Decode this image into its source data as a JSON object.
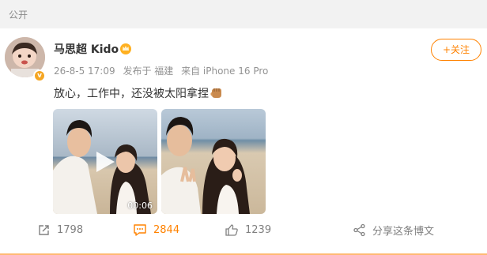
{
  "header": {
    "visibility": "公开"
  },
  "post": {
    "author": {
      "name": "马思超 Kido",
      "verified_badge": "v"
    },
    "meta": {
      "time": "26-8-5 17:09",
      "location": "发布于 福建",
      "source": "来自 iPhone 16 Pro"
    },
    "follow_label": "+关注",
    "text": "放心，工作中，还没被太阳拿捏",
    "media": [
      {
        "type": "video",
        "duration": "00:06"
      },
      {
        "type": "photo"
      }
    ],
    "actions": {
      "repost_count": "1798",
      "comment_count": "2844",
      "like_count": "1239",
      "share_label": "分享这条博文"
    }
  },
  "colors": {
    "accent": "#ff8200",
    "meta_gray": "#939393",
    "verified": "#f5a623"
  }
}
